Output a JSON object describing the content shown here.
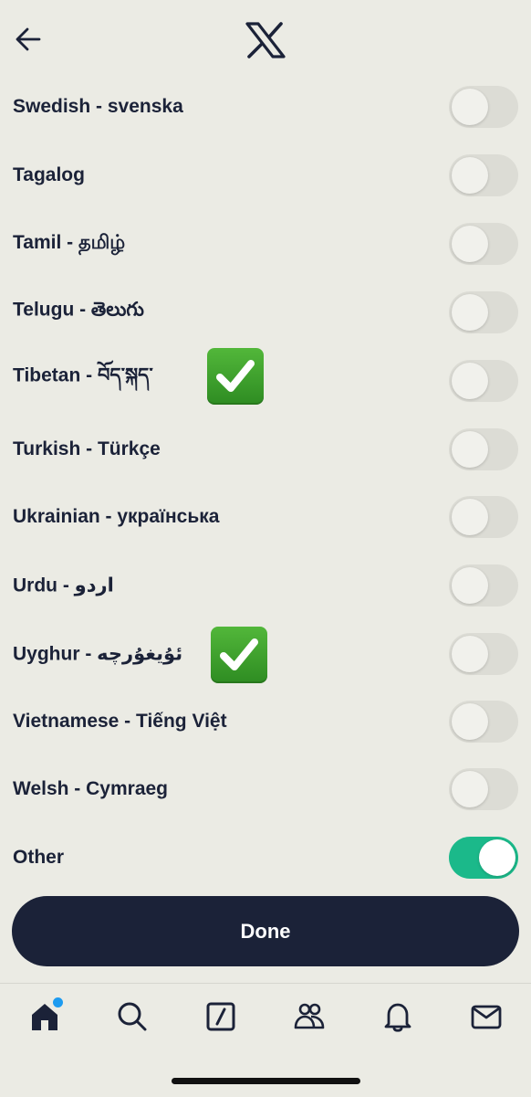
{
  "languages": [
    {
      "label": "Swedish - svenska",
      "on": false
    },
    {
      "label": "Tagalog",
      "on": false
    },
    {
      "label": "Tamil - தமிழ்",
      "on": false
    },
    {
      "label": "Telugu - తెలుగు",
      "on": false
    },
    {
      "label": "Tibetan - བོད་སྐད་",
      "on": false
    },
    {
      "label": "Turkish - Türkçe",
      "on": false
    },
    {
      "label": "Ukrainian - українська",
      "on": false
    },
    {
      "label": "Urdu - اردو",
      "on": false
    },
    {
      "label": "Uyghur - ئۇيغۇرچە",
      "on": false
    },
    {
      "label": "Vietnamese - Tiếng Việt",
      "on": false
    },
    {
      "label": "Welsh - Cymraeg",
      "on": false
    },
    {
      "label": "Other",
      "on": true
    }
  ],
  "done_label": "Done",
  "colors": {
    "accent": "#1bb98a",
    "button": "#1b2238",
    "badge": "#1d9bf0",
    "check": "#3ea82e"
  },
  "icons": {
    "header": [
      "back-arrow-icon",
      "x-logo-icon"
    ],
    "annotations": [
      "check-mark-icon",
      "check-mark-icon"
    ],
    "tabs": [
      "home-icon",
      "search-icon",
      "compose-icon",
      "communities-icon",
      "notifications-icon",
      "messages-icon"
    ]
  }
}
